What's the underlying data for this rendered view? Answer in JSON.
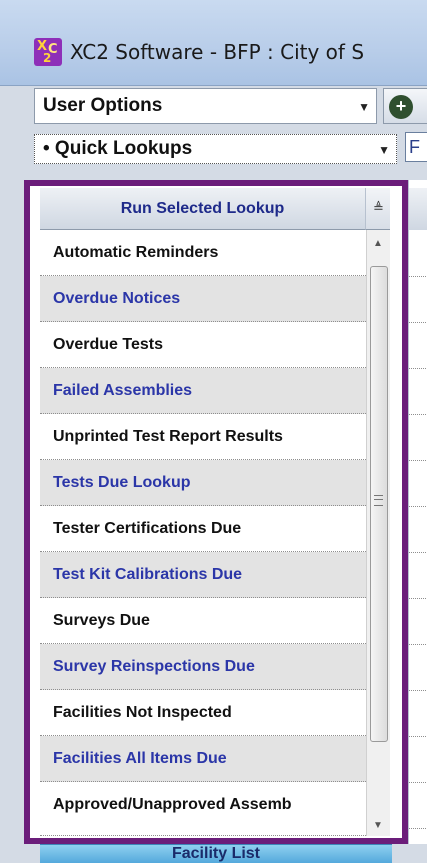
{
  "window": {
    "title": "XC2 Software - BFP : City of S",
    "icon_text": [
      "X",
      "C",
      "2"
    ]
  },
  "user_options": {
    "label": "User Options"
  },
  "quick_lookups": {
    "label": "• Quick Lookups"
  },
  "side_box_letter": "F",
  "lookup_grid": {
    "header": "Run Selected Lookup",
    "items": [
      "Automatic Reminders",
      "Overdue Notices",
      "Overdue Tests",
      "Failed Assemblies",
      "Unprinted Test Report Results",
      "Tests Due Lookup",
      "Tester Certifications Due",
      "Test Kit Calibrations Due",
      "Surveys Due",
      "Survey Reinspections Due",
      "Facilities Not Inspected",
      "Facilities All Items Due",
      "Approved/Unapproved Assemb"
    ]
  },
  "bottom_tab": {
    "label": "Facility List"
  },
  "colors": {
    "frame": "#6b1d7a",
    "odd_text": "#2b36a8",
    "even_text": "#111111",
    "header_text": "#1e2a8a"
  }
}
